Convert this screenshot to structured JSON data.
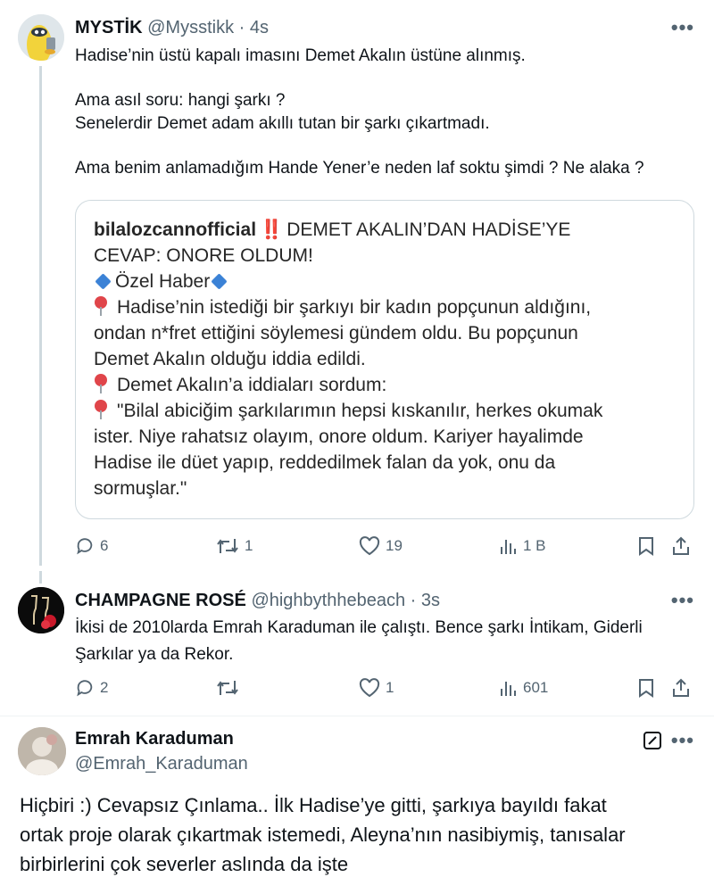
{
  "tweet1": {
    "name": "MYSTİK",
    "handle": "@Mysstikk",
    "time": "4s",
    "more": "•••",
    "lines": [
      "Hadise’nin üstü kapalı imasını Demet Akalın üstüne alınmış.",
      "",
      "Ama asıl soru: hangi şarkı ?",
      "Senelerdir Demet adam akıllı tutan bir şarkı çıkartmadı.",
      "",
      "Ama benim anlamadığım Hande Yener’e neden laf soktu şimdi ? Ne alaka ?"
    ],
    "quote": {
      "user": "bilalozcannofficial",
      "bang": "‼️",
      "headline_1": "DEMET AKALIN’DAN HADİSE’YE",
      "headline_2": "CEVAP: ONORE OLDUM!",
      "tag": "Özel Haber",
      "p1_1": "Hadise’nin istediği bir şarkıyı bir kadın popçunun aldığını,",
      "p1_2": "ondan n*fret ettiğini söylemesi gündem oldu. Bu popçunun",
      "p1_3": "Demet Akalın olduğu iddia edildi.",
      "p2": "Demet Akalın’a iddiaları sordum:",
      "p3_1": "\"Bilal abiciğim şarkılarımın hepsi kıskanılır, herkes okumak",
      "p3_2": "ister. Niye rahatsız olayım, onore oldum. Kariyer hayalimde",
      "p3_3": "Hadise ile düet yapıp, reddedilmek falan da yok, onu da",
      "p3_4": "sormuşlar.\""
    },
    "actions": {
      "replies": "6",
      "retweets": "1",
      "likes": "19",
      "views": "1 B"
    }
  },
  "tweet2": {
    "name": "CHAMPAGNE ROSÉ",
    "handle": "@highbythhebeach",
    "time": "3s",
    "more": "•••",
    "line1": "İkisi de 2010larda Emrah Karaduman ile çalıştı. Bence şarkı İntikam, Giderli",
    "line2": "Şarkılar ya da Rekor.",
    "actions": {
      "replies": "2",
      "retweets": "",
      "likes": "1",
      "views": "601"
    }
  },
  "tweet3": {
    "name": "Emrah Karaduman",
    "handle": "@Emrah_Karaduman",
    "more": "•••",
    "line1": "Hiçbiri :) Cevapsız Çınlama.. İlk Hadise’ye gitti, şarkıya bayıldı fakat",
    "line2": "ortak proje olarak çıkartmak istemedi, Aleyna’nın nasibiymiş,  tanısalar",
    "line3": "birbirlerini çok severler aslında da işte"
  },
  "colors": {
    "text": "#0f1419",
    "muted": "#536471",
    "border": "#cfd9de",
    "pin": "#e0454a",
    "diamond": "#3b82d6"
  },
  "icons": [
    "reply-icon",
    "retweet-icon",
    "like-icon",
    "views-icon",
    "bookmark-icon",
    "share-icon",
    "edit-icon",
    "pin-icon",
    "diamond-icon"
  ]
}
